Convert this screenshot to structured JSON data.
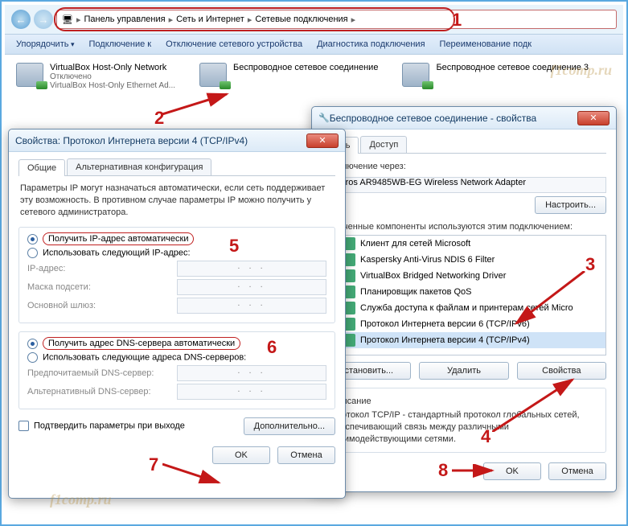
{
  "explorer": {
    "breadcrumb": [
      "Панель управления",
      "Сеть и Интернет",
      "Сетевые подключения"
    ],
    "toolbar": {
      "organize": "Упорядочить",
      "connect": "Подключение к",
      "disable": "Отключение сетевого устройства",
      "diagnose": "Диагностика подключения",
      "rename": "Переименование подк"
    },
    "networks": [
      {
        "title": "VirtualBox Host-Only Network",
        "status": "Отключено",
        "adapter": "VirtualBox Host-Only Ethernet Ad..."
      },
      {
        "title": "Беспроводное сетевое соединение",
        "status": "",
        "adapter": ""
      },
      {
        "title": "Беспроводное сетевое соединение 3",
        "status": "",
        "adapter": ""
      }
    ]
  },
  "props_dialog": {
    "title": "Беспроводное сетевое соединение - свойства",
    "tabs": {
      "net": "Сеть",
      "access": "Доступ"
    },
    "connect_via": "Подключение через:",
    "adapter": "Atheros AR9485WB-EG Wireless Network Adapter",
    "configure": "Настроить...",
    "comp_label": "Отмеченные компоненты используются этим подключением:",
    "components": [
      "Клиент для сетей Microsoft",
      "Kaspersky Anti-Virus NDIS 6 Filter",
      "VirtualBox Bridged Networking Driver",
      "Планировщик пакетов QoS",
      "Служба доступа к файлам и принтерам сетей Micro",
      "Протокол Интернета версии 6 (TCP/IPv6)",
      "Протокол Интернета версии 4 (TCP/IPv4)"
    ],
    "install": "Установить...",
    "remove": "Удалить",
    "properties": "Свойства",
    "desc_title": "Описание",
    "desc": "Протокол TCP/IP - стандартный протокол глобальных сетей, обеспечивающий связь между различными взаимодействующими сетями.",
    "ok": "OK",
    "cancel": "Отмена"
  },
  "ipv4_dialog": {
    "title": "Свойства: Протокол Интернета версии 4 (TCP/IPv4)",
    "tabs": {
      "general": "Общие",
      "alt": "Альтернативная конфигурация"
    },
    "intro": "Параметры IP могут назначаться автоматически, если сеть поддерживает эту возможность. В противном случае параметры IP можно получить у сетевого администратора.",
    "radio_ip_auto": "Получить IP-адрес автоматически",
    "radio_ip_manual": "Использовать следующий IP-адрес:",
    "lbl_ip": "IP-адрес:",
    "lbl_mask": "Маска подсети:",
    "lbl_gw": "Основной шлюз:",
    "radio_dns_auto": "Получить адрес DNS-сервера автоматически",
    "radio_dns_manual": "Использовать следующие адреса DNS-серверов:",
    "lbl_dns1": "Предпочитаемый DNS-сервер:",
    "lbl_dns2": "Альтернативный DNS-сервер:",
    "chk_validate": "Подтвердить параметры при выходе",
    "advanced": "Дополнительно...",
    "ok": "OK",
    "cancel": "Отмена"
  },
  "watermark": "f1comp.ru"
}
